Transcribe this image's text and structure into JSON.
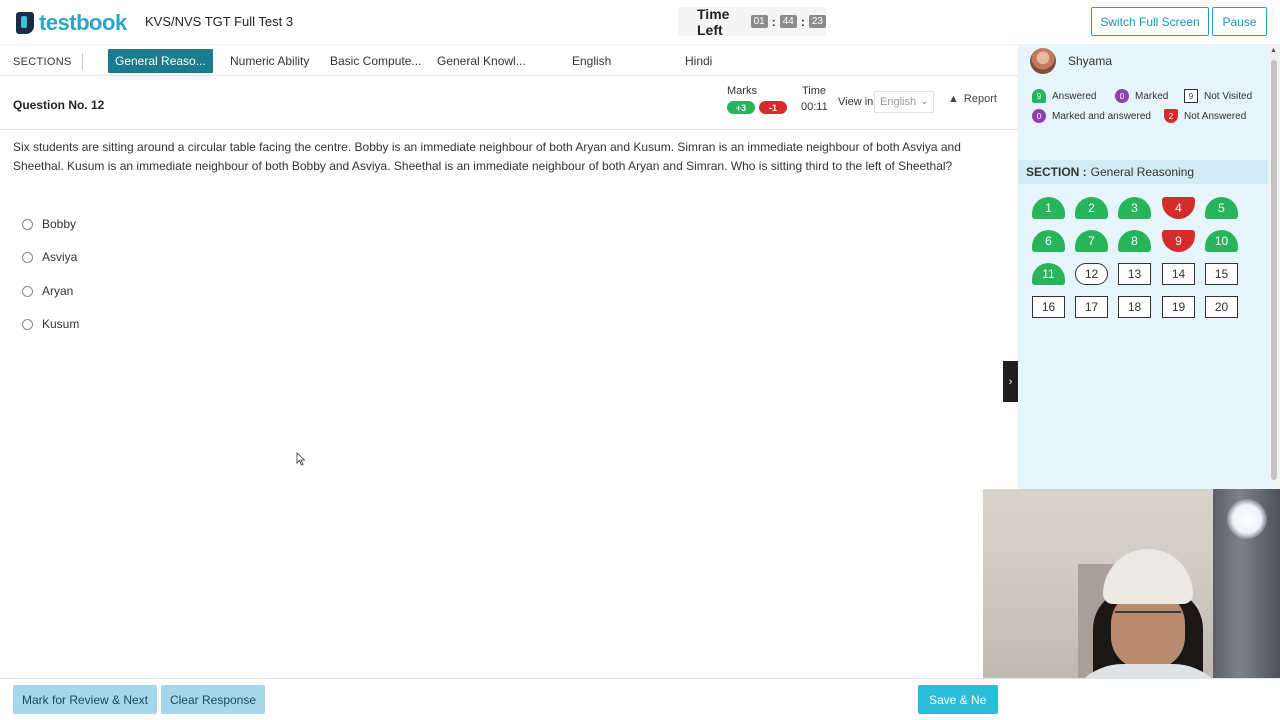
{
  "header": {
    "logo_text": "testbook",
    "test_title": "KVS/NVS TGT Full Test 3",
    "time_left_label": "Time Left",
    "time_hours": "01",
    "time_minutes": "44",
    "time_seconds": "23",
    "time_sep": ":",
    "switch_fullscreen_label": "Switch Full Screen",
    "pause_label": "Pause"
  },
  "sections": {
    "label": "SECTIONS",
    "tabs": [
      {
        "label": "General Reaso...",
        "active": true
      },
      {
        "label": "Numeric Ability",
        "active": false
      },
      {
        "label": "Basic Compute...",
        "active": false
      },
      {
        "label": "General Knowl...",
        "active": false
      },
      {
        "label": "English",
        "active": false
      },
      {
        "label": "Hindi",
        "active": false
      }
    ]
  },
  "question_header": {
    "number_label": "Question No. 12",
    "marks_label": "Marks",
    "positive_marks": "+3",
    "negative_marks": "-1",
    "time_label": "Time",
    "time_value": "00:11",
    "view_in_label": "View in",
    "language_selected": "English",
    "report_label": "Report"
  },
  "question": {
    "text": "Six students are sitting around a circular table facing the centre. Bobby is an immediate neighbour of both Aryan and Kusum. Simran is an immediate neighbour of both Asviya and Sheethal. Kusum is an immediate neighbour of both Bobby and Asviya. Sheethal is an immediate neighbour of both Aryan and Simran. Who is sitting third to the left of Sheethal?",
    "options": [
      "Bobby",
      "Asviya",
      "Aryan",
      "Kusum"
    ]
  },
  "footer": {
    "mark_review_label": "Mark for Review & Next",
    "clear_response_label": "Clear Response",
    "save_next_label": "Save & Ne"
  },
  "panel": {
    "user_name": "Shyama",
    "legend": {
      "answered_count": "9",
      "answered_label": "Answered",
      "marked_count": "0",
      "marked_label": "Marked",
      "not_visited_count": "9",
      "not_visited_label": "Not Visited",
      "marked_answered_count": "0",
      "marked_answered_label": "Marked and answered",
      "not_answered_count": "2",
      "not_answered_label": "Not Answered"
    },
    "section_prefix": "SECTION :",
    "section_name": "General Reasoning",
    "questions": [
      {
        "n": "1",
        "status": "answered"
      },
      {
        "n": "2",
        "status": "answered"
      },
      {
        "n": "3",
        "status": "answered"
      },
      {
        "n": "4",
        "status": "notans"
      },
      {
        "n": "5",
        "status": "answered"
      },
      {
        "n": "6",
        "status": "answered"
      },
      {
        "n": "7",
        "status": "answered"
      },
      {
        "n": "8",
        "status": "answered"
      },
      {
        "n": "9",
        "status": "notans"
      },
      {
        "n": "10",
        "status": "answered"
      },
      {
        "n": "11",
        "status": "answered"
      },
      {
        "n": "12",
        "status": "current"
      },
      {
        "n": "13",
        "status": "notvisited"
      },
      {
        "n": "14",
        "status": "notvisited"
      },
      {
        "n": "15",
        "status": "notvisited"
      },
      {
        "n": "16",
        "status": "notvisited"
      },
      {
        "n": "17",
        "status": "notvisited"
      },
      {
        "n": "18",
        "status": "notvisited"
      },
      {
        "n": "19",
        "status": "notvisited"
      },
      {
        "n": "20",
        "status": "notvisited"
      }
    ]
  },
  "colors": {
    "brand": "#2aa6c8",
    "active_tab": "#1b7a8d",
    "answered": "#27b45b",
    "not_answered": "#d52b2b",
    "marked": "#8e3fb0",
    "panel_bg": "#e5f5fb"
  },
  "icons": {
    "report": "warning-triangle-icon",
    "panel_toggle": "chevron-right-icon",
    "cursor": "mouse-pointer-icon"
  }
}
